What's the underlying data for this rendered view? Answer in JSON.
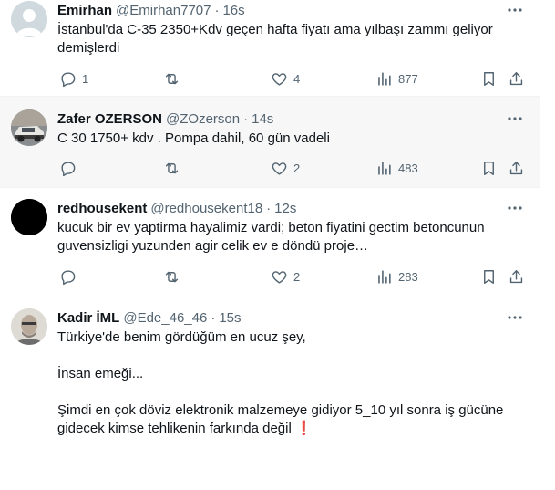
{
  "tweets": [
    {
      "name": "Emirhan",
      "handle": "@Emirhan7707",
      "sep": "·",
      "time": "16s",
      "lines": [
        "İstanbul'da C-35 2350+Kdv geçen hafta fiyatı ama yılbaşı zammı geliyor demişlerdi"
      ],
      "replies": "1",
      "retweets": "",
      "likes": "4",
      "views": "877"
    },
    {
      "name": "Zafer OZERSON",
      "handle": "@ZOzerson",
      "sep": "·",
      "time": "14s",
      "lines": [
        "C 30 1750+ kdv . Pompa dahil, 60 gün vadeli"
      ],
      "replies": "",
      "retweets": "",
      "likes": "2",
      "views": "483"
    },
    {
      "name": "redhousekent",
      "handle": "@redhousekent18",
      "sep": "·",
      "time": "12s",
      "lines": [
        "kucuk bir ev yaptirma hayalimiz vardi; beton fiyatini gectim betoncunun guvensizligi yuzunden agir celik ev e döndü proje…"
      ],
      "replies": "",
      "retweets": "",
      "likes": "2",
      "views": "283"
    },
    {
      "name": "Kadir İML",
      "handle": "@Ede_46_46",
      "sep": "·",
      "time": "15s",
      "lines": [
        "Türkiye'de benim gördüğüm en ucuz şey,",
        "",
        "İnsan emeği...",
        "",
        "Şimdi en çok döviz elektronik malzemeye gidiyor 5_10 yıl sonra iş gücüne gidecek kimse tehlikenin farkında değil"
      ],
      "emoji": "❗"
    }
  ],
  "icons": {
    "reply": "reply-icon",
    "retweet": "retweet-icon",
    "like": "like-icon",
    "views": "views-icon",
    "bookmark": "bookmark-icon",
    "share": "share-icon",
    "more": "more-icon"
  },
  "colors": {
    "text": "#0f1419",
    "secondary": "#536471",
    "highlight_bg": "#f7f7f7",
    "divider": "#eff3f4",
    "emoji": "#d8202a"
  }
}
